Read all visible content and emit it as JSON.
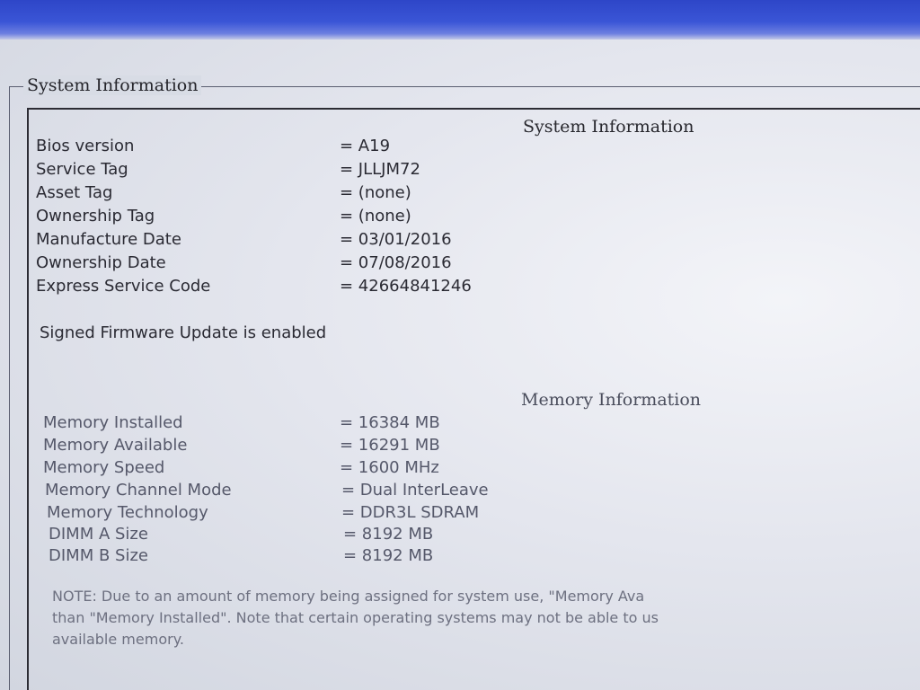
{
  "group_title": "System Information",
  "system": {
    "heading": "System Information",
    "rows": [
      {
        "label": "Bios version",
        "value": "= A19"
      },
      {
        "label": "Service Tag",
        "value": "= JLLJM72"
      },
      {
        "label": "Asset Tag",
        "value": "= (none)"
      },
      {
        "label": "Ownership Tag",
        "value": "= (none)"
      },
      {
        "label": "Manufacture Date",
        "value": "= 03/01/2016"
      },
      {
        "label": "Ownership Date",
        "value": "= 07/08/2016"
      },
      {
        "label": "Express Service Code",
        "value": "= 42664841246"
      }
    ],
    "status": "Signed Firmware Update is enabled"
  },
  "memory": {
    "heading": "Memory Information",
    "rows": [
      {
        "label": "Memory Installed",
        "value": "= 16384 MB"
      },
      {
        "label": "Memory Available",
        "value": "= 16291 MB"
      },
      {
        "label": "Memory Speed",
        "value": "= 1600 MHz"
      },
      {
        "label": "Memory Channel Mode",
        "value": "= Dual InterLeave"
      },
      {
        "label": "Memory Technology",
        "value": "= DDR3L SDRAM"
      },
      {
        "label": "DIMM A Size",
        "value": "= 8192 MB"
      },
      {
        "label": "DIMM B Size",
        "value": "= 8192 MB"
      }
    ],
    "note_lines": [
      "NOTE: Due to an amount of memory being assigned for system use, \"Memory Ava",
      "than \"Memory Installed\". Note that certain operating systems may not be able to us",
      "available memory."
    ]
  }
}
